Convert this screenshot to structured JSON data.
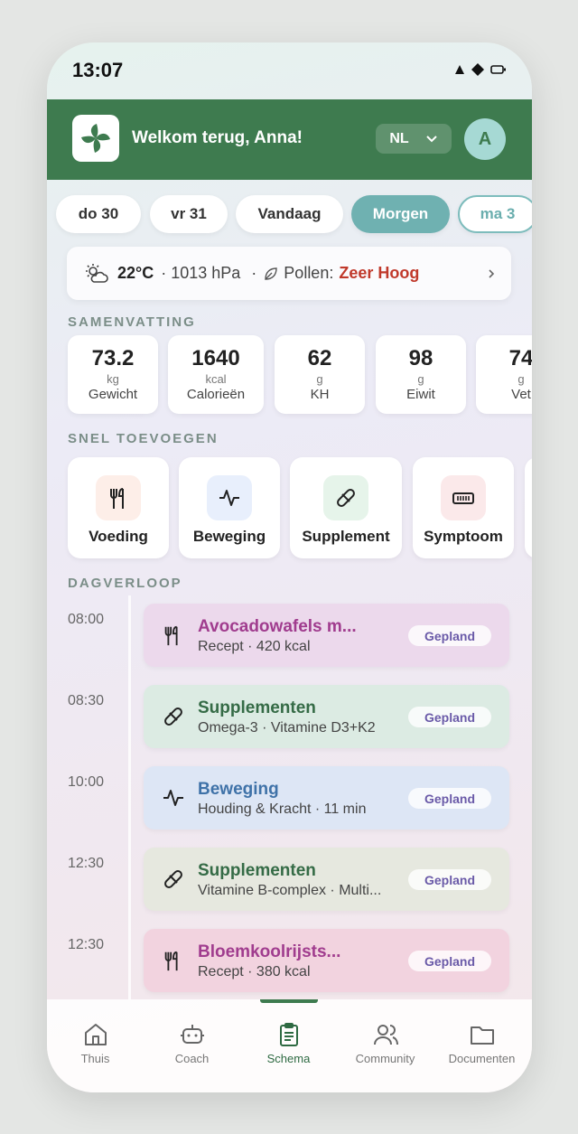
{
  "status": {
    "time": "13:07"
  },
  "header": {
    "welcome": "Welkom terug, Anna!",
    "language": "NL",
    "avatar_initial": "A"
  },
  "dates": [
    {
      "label": "do 30",
      "state": "normal"
    },
    {
      "label": "vr 31",
      "state": "normal"
    },
    {
      "label": "Vandaag",
      "state": "normal"
    },
    {
      "label": "Morgen",
      "state": "selected"
    },
    {
      "label": "ma 3",
      "state": "outline"
    }
  ],
  "weather": {
    "temperature": "22°C",
    "pressure": "· 1013 hPa",
    "pollen_label": "Pollen:",
    "pollen_level": "Zeer Hoog",
    "sep": "·"
  },
  "summary": {
    "title": "SAMENVATTING",
    "stats": [
      {
        "value": "73.2",
        "unit": "kg",
        "label": "Gewicht"
      },
      {
        "value": "1640",
        "unit": "kcal",
        "label": "Calorieën"
      },
      {
        "value": "62",
        "unit": "g",
        "label": "KH"
      },
      {
        "value": "98",
        "unit": "g",
        "label": "Eiwit"
      },
      {
        "value": "74",
        "unit": "g",
        "label": "Vet"
      }
    ]
  },
  "quick_add": {
    "title": "SNEL TOEVOEGEN",
    "items": [
      {
        "label": "Voeding",
        "icon": "fork-knife-icon",
        "color": "#fdeee8"
      },
      {
        "label": "Beweging",
        "icon": "activity-icon",
        "color": "#e8effc"
      },
      {
        "label": "Supplement",
        "icon": "pill-icon",
        "color": "#e6f4ea"
      },
      {
        "label": "Symptoom",
        "icon": "thermometer-icon",
        "color": "#fbe9ea"
      }
    ]
  },
  "timeline": {
    "title": "DAGVERLOOP",
    "entries": [
      {
        "time": "08:00",
        "title": "Avocadowafels m...",
        "subtitle": "Recept · 420 kcal",
        "badge": "Gepland",
        "icon": "fork-knife-icon",
        "title_color": "#a03c8e",
        "bg": "#ecd9ec"
      },
      {
        "time": "08:30",
        "title": "Supplementen",
        "subtitle": "Omega-3 · Vitamine D3+K2",
        "badge": "Gepland",
        "icon": "pill-icon",
        "title_color": "#356b46",
        "bg": "#dcebe3"
      },
      {
        "time": "10:00",
        "title": "Beweging",
        "subtitle": "Houding & Kracht · 11 min",
        "badge": "Gepland",
        "icon": "activity-icon",
        "title_color": "#3f72a8",
        "bg": "#dde6f5"
      },
      {
        "time": "12:30",
        "title": "Supplementen",
        "subtitle": "Vitamine B-complex · Multi...",
        "badge": "Gepland",
        "icon": "pill-icon",
        "title_color": "#356b46",
        "bg": "#e6e8df"
      },
      {
        "time": "12:30",
        "title": "Bloemkoolrijsts...",
        "subtitle": "Recept · 380 kcal",
        "badge": "Gepland",
        "icon": "fork-knife-icon",
        "title_color": "#a03c8e",
        "bg": "#f2d3df"
      }
    ]
  },
  "nav": {
    "items": [
      {
        "label": "Thuis",
        "icon": "home-icon"
      },
      {
        "label": "Coach",
        "icon": "robot-icon"
      },
      {
        "label": "Schema",
        "icon": "clipboard-icon",
        "active": true
      },
      {
        "label": "Community",
        "icon": "users-icon"
      },
      {
        "label": "Documenten",
        "icon": "folder-icon"
      }
    ]
  }
}
